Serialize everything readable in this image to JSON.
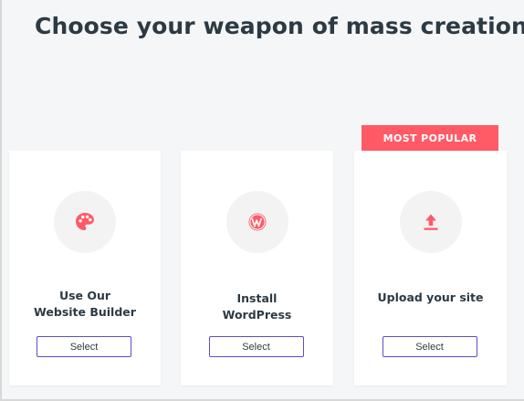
{
  "page": {
    "title": "Choose your weapon of mass creation"
  },
  "options": [
    {
      "title_lines": [
        "Use Our",
        "Website Builder"
      ],
      "icon": "palette-icon",
      "button_label": "Select"
    },
    {
      "title_lines": [
        "Install",
        "WordPress"
      ],
      "icon": "wordpress-icon",
      "button_label": "Select"
    },
    {
      "badge": "MOST POPULAR",
      "title_lines": [
        "Upload your site"
      ],
      "icon": "upload-icon",
      "button_label": "Select"
    }
  ],
  "colors": {
    "accent": "#ff5a66",
    "button_border": "#5b4ec8",
    "title_text": "#2c3a44",
    "background": "#f5f6f8",
    "icon_circle": "#f3f3f4"
  }
}
